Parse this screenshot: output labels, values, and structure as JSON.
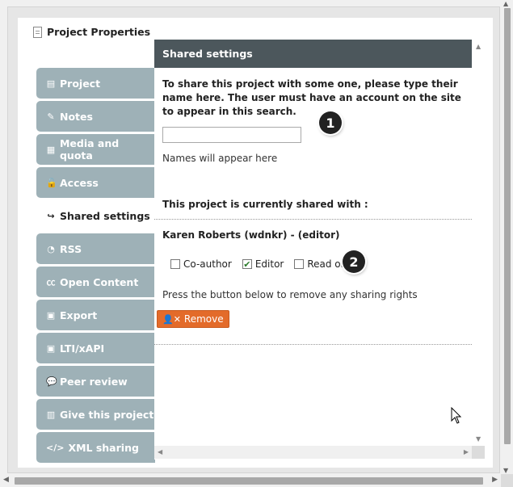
{
  "window": {
    "title": "Project Properties"
  },
  "tabs": [
    {
      "label": "Project",
      "icon": "file-icon",
      "glyph": "▤",
      "active": false
    },
    {
      "label": "Notes",
      "icon": "edit-icon",
      "glyph": "✎",
      "active": false
    },
    {
      "label": "Media and quota",
      "icon": "film-icon",
      "glyph": "▦",
      "active": false
    },
    {
      "label": "Access",
      "icon": "unlock-icon",
      "glyph": "🔓",
      "active": false
    },
    {
      "label": "Shared settings",
      "icon": "share-icon",
      "glyph": "↪",
      "active": true
    },
    {
      "label": "RSS",
      "icon": "rss-icon",
      "glyph": "◔",
      "active": false
    },
    {
      "label": "Open Content",
      "icon": "cc-icon",
      "glyph": "㏄",
      "active": false
    },
    {
      "label": "Export",
      "icon": "save-icon",
      "glyph": "▣",
      "active": false
    },
    {
      "label": "LTI/xAPI",
      "icon": "save-icon",
      "glyph": "▣",
      "active": false
    },
    {
      "label": "Peer review",
      "icon": "comments-icon",
      "glyph": "💬",
      "active": false
    },
    {
      "label": "Give this project",
      "icon": "gift-icon",
      "glyph": "▥",
      "active": false
    },
    {
      "label": "XML sharing",
      "icon": "code-icon",
      "glyph": "</>",
      "active": false
    }
  ],
  "content": {
    "header": "Shared settings",
    "intro": "To share this project with some one, please type their name here. The user must have an account on the site to appear in this search.",
    "search_value": "",
    "names_hint": "Names will appear here",
    "shared_with_heading": "This project is currently shared with :",
    "user": "Karen Roberts (wdnkr) - (editor)",
    "permissions": [
      {
        "label": "Co-author",
        "checked": false
      },
      {
        "label": "Editor",
        "checked": true
      },
      {
        "label": "Read only",
        "checked": false
      }
    ],
    "remove_note": "Press the button below to remove any sharing rights",
    "remove_button": "Remove",
    "badge1": "1",
    "badge2": "2"
  },
  "colors": {
    "tab_bg": "#9eb1b7",
    "header_bg": "#4c575c",
    "remove_bg": "#e36b2a"
  }
}
